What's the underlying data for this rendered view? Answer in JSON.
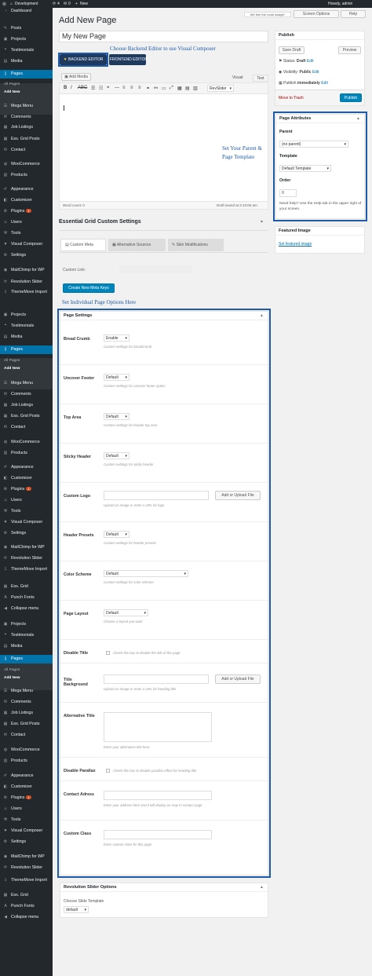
{
  "admin_bar": {
    "site_name": "Development",
    "updates": "4",
    "comments": "0",
    "new_label": "New",
    "tagline": "We feel the room swayin'",
    "howdy": "Howdy, admin"
  },
  "sidebar": {
    "group1": [
      "Dashboard",
      "Posts",
      "Projects",
      "Testimonials",
      "Media",
      "Pages",
      "All Pages",
      "Add New",
      "Mega Menu",
      "Comments",
      "Job Listings",
      "Ess. Grid Posts",
      "Contact",
      "WooCommerce",
      "Products",
      "Appearance",
      "Customizer",
      "Plugins",
      "Users",
      "Tools",
      "Visual Composer",
      "Settings",
      "MailChimp for WP",
      "Revolution Slider",
      "ThemeMove Import"
    ],
    "group2": [
      "Projects",
      "Testimonials",
      "Media",
      "Pages",
      "All Pages",
      "Add New",
      "Mega Menu",
      "Comments",
      "Job Listings",
      "Ess. Grid Posts",
      "Contact",
      "WooCommerce",
      "Products",
      "Appearance",
      "Customizer",
      "Plugins",
      "Users",
      "Tools",
      "Visual Composer",
      "Settings",
      "MailChimp for WP",
      "Revolution Slider",
      "ThemeMove Import",
      "Ess. Grid",
      "Punch Fonts",
      "Collapse menu"
    ],
    "group3": [
      "Projects",
      "Testimonials",
      "Media",
      "Pages",
      "All Pages",
      "Add New",
      "Mega Menu",
      "Comments",
      "Job Listings",
      "Ess. Grid Posts",
      "Contact",
      "WooCommerce",
      "Products",
      "Appearance",
      "Customizer",
      "Plugins",
      "Users",
      "Tools",
      "Visual Composer",
      "Settings",
      "MailChimp for WP",
      "Revolution Slider",
      "ThemeMove Import",
      "Ess. Grid",
      "Punch Fonts",
      "Collapse menu"
    ],
    "plugins_badge": "1"
  },
  "screen_options": "Screen Options",
  "help": "Help",
  "page_heading": "Add New Page",
  "title_value": "My New Page",
  "editor": {
    "backend": "BACKEND EDITOR",
    "frontend": "FRONTEND EDITOR",
    "add_media": "Add Media",
    "tab_visual": "Visual",
    "tab_text": "Text",
    "format": "Paragraph",
    "revslider": "RevSlider",
    "word_count": "Word count: 0",
    "draft_saved": "Draft saved at 2:13:06 am."
  },
  "annotations": {
    "backend": "Choose Backend Editor to use Visual Composer",
    "parent_line1": "Set Your Parent &",
    "parent_line2": "Page Template",
    "options": "Set Individual Page Options Here"
  },
  "publish": {
    "title": "Publish",
    "save_draft": "Save Draft",
    "preview": "Preview",
    "status_label": "Status:",
    "status_value": "Draft",
    "visibility_label": "Visibility:",
    "visibility_value": "Public",
    "publish_label": "Publish",
    "publish_value": "immediately",
    "edit": "Edit",
    "trash": "Move to Trash",
    "publish_btn": "Publish"
  },
  "page_attributes": {
    "title": "Page Attributes",
    "parent_label": "Parent",
    "parent_value": "(no parent)",
    "template_label": "Template",
    "template_value": "Default Template",
    "order_label": "Order",
    "order_value": "0",
    "help": "Need help? Use the Help tab in the upper right of your screen."
  },
  "featured": {
    "title": "Featured Image",
    "link": "Set featured image"
  },
  "ess_grid": {
    "title": "Essential Grid Custom Settings",
    "tab1": "Custom Meta",
    "tab2": "Alternative Sources",
    "tab3": "Skin Modifications",
    "custom_link": "Custom Link:",
    "button": "Create New Meta Keys"
  },
  "page_settings": {
    "title": "Page Settings",
    "rows": [
      {
        "label": "Bread Crumb",
        "value": "Enable",
        "desc": "Custom settings for breadcrumb"
      },
      {
        "label": "Uncover Footer",
        "value": "Default",
        "desc": "Custom settings for uncover footer option"
      },
      {
        "label": "Top Area",
        "value": "Default",
        "desc": "Custom settings for header top area"
      },
      {
        "label": "Sticky Header",
        "value": "Default",
        "desc": "Custom settings for sticky header"
      },
      {
        "label": "Custom Logo",
        "button": "Add or Upload File",
        "desc": "Upload an image or enter a URL for logo"
      },
      {
        "label": "Header Presets",
        "value": "Default",
        "desc": "Custom settings for header presets"
      },
      {
        "label": "Color Scheme",
        "value": "Default",
        "desc": "Custom settings for color scheme"
      },
      {
        "label": "Page Layout",
        "value": "Default",
        "desc": "Choose a layout you want"
      },
      {
        "label": "Disable Title",
        "check": "Check this box to disable the title of the page"
      },
      {
        "label": "Title",
        "label2": "Background",
        "button": "Add or Upload File",
        "desc": "Upload an image or enter a URL for heading title"
      },
      {
        "label": "Alternative Title",
        "desc": "Enter your alternative title here"
      },
      {
        "label": "Disable Parallax",
        "check": "Check this box to disable parallax effect for heading title"
      },
      {
        "label": "Contact Adress",
        "desc": "Enter your address here and it will display on map in contact page"
      },
      {
        "label": "Custom Class",
        "desc": "Enter custom class for this page"
      }
    ]
  },
  "rev_slider": {
    "title": "Revolution Slider Options",
    "label": "Choose Slide Template",
    "value": "default"
  },
  "colors": {
    "admin_dark": "#23282d",
    "wp_blue": "#0073aa",
    "annotation_blue": "#1e5aa8"
  }
}
